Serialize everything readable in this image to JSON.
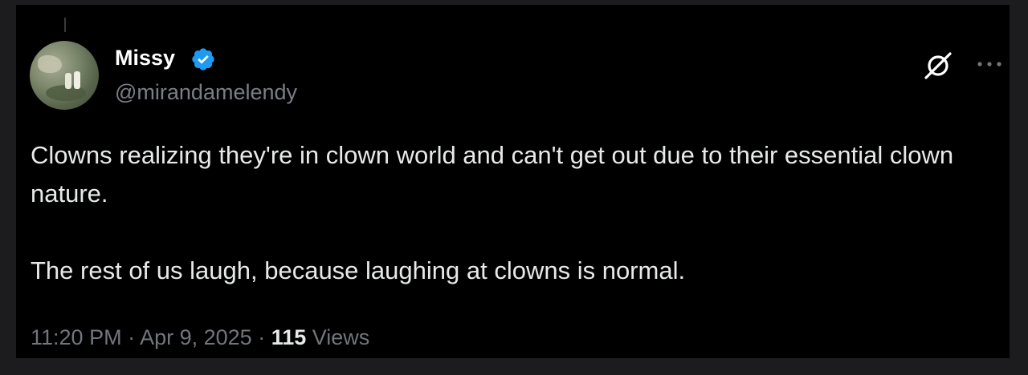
{
  "author": {
    "display_name": "Missy",
    "handle": "@mirandamelendy",
    "verified": true,
    "avatar_icon": "avatar-photo"
  },
  "tweet": {
    "paragraphs": [
      "Clowns realizing they're in clown world and can't get out due to their essential clown nature.",
      "The rest of us laugh, because laughing at clowns is normal."
    ]
  },
  "meta": {
    "time": "11:20 PM",
    "separator": " · ",
    "date": "Apr 9, 2025",
    "views_count": "115",
    "views_label": " Views"
  },
  "icons": {
    "verified": "verified-badge-icon",
    "grok": "grok-icon",
    "more": "more-options-icon"
  },
  "colors": {
    "background": "#000000",
    "text": "#e7e9ea",
    "secondary": "#72767b",
    "verified": "#1d9bf0"
  }
}
